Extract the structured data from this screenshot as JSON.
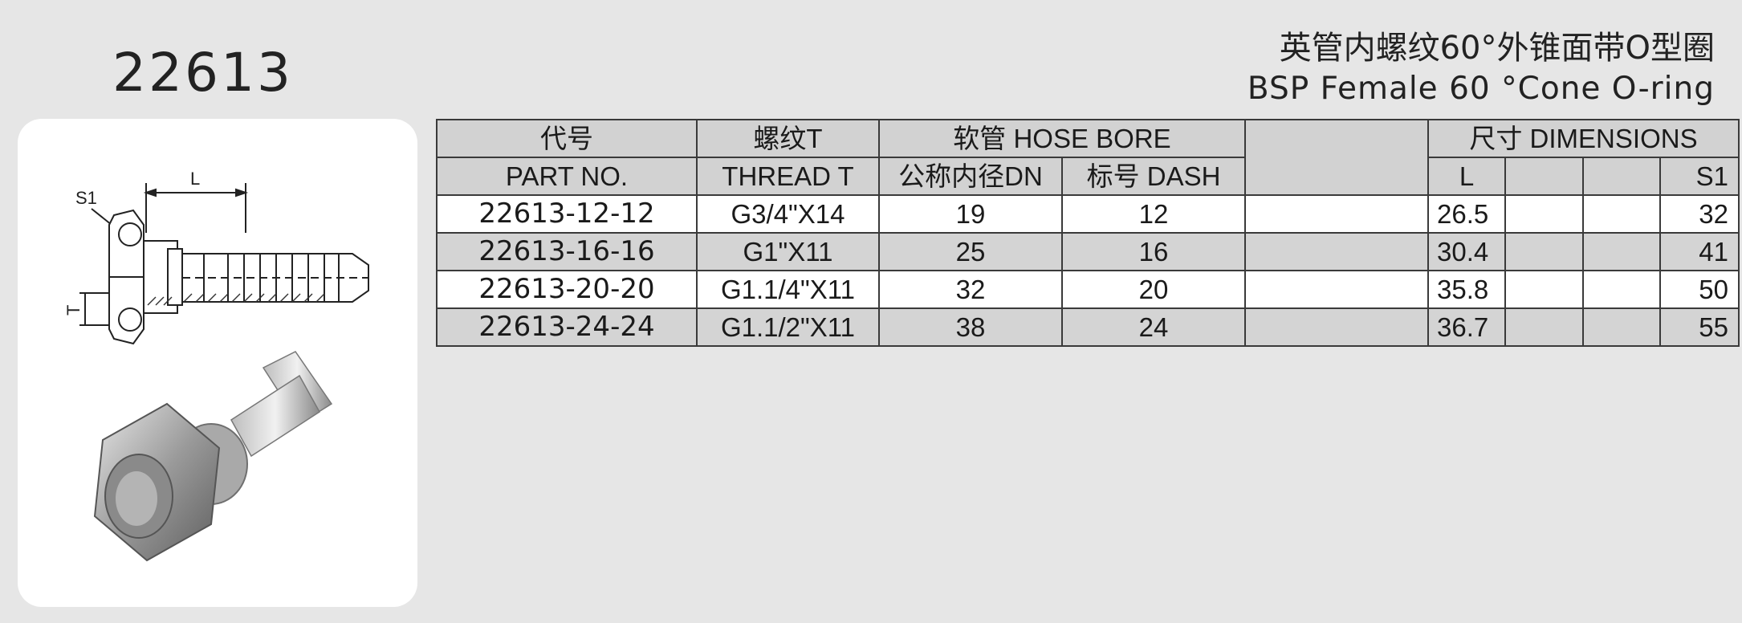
{
  "part_code": "22613",
  "title_cn": "英管内螺纹60°外锥面带O型圈",
  "title_en": "BSP Female 60 °Cone O-ring",
  "drawing_labels": {
    "s1": "S1",
    "l": "L",
    "t": "T"
  },
  "table": {
    "header_row1": {
      "part_cn": "代号",
      "thread_cn": "螺纹T",
      "hose_bore": "软管 HOSE BORE",
      "blank": "",
      "dimensions": "尺寸  DIMENSIONS"
    },
    "header_row2": {
      "part_no": "PART NO.",
      "thread": "THREAD T",
      "dn": "公称内径DN",
      "dash": "标号  DASH",
      "l": "L",
      "s1": "S1"
    },
    "rows": [
      {
        "part_no": "22613-12-12",
        "thread": "G3/4\"X14",
        "dn": "19",
        "dash": "12",
        "l": "26.5",
        "s1": "32"
      },
      {
        "part_no": "22613-16-16",
        "thread": "G1\"X11",
        "dn": "25",
        "dash": "16",
        "l": "30.4",
        "s1": "41"
      },
      {
        "part_no": "22613-20-20",
        "thread": "G1.1/4\"X11",
        "dn": "32",
        "dash": "20",
        "l": "35.8",
        "s1": "50"
      },
      {
        "part_no": "22613-24-24",
        "thread": "G1.1/2\"X11",
        "dn": "38",
        "dash": "24",
        "l": "36.7",
        "s1": "55"
      }
    ]
  }
}
